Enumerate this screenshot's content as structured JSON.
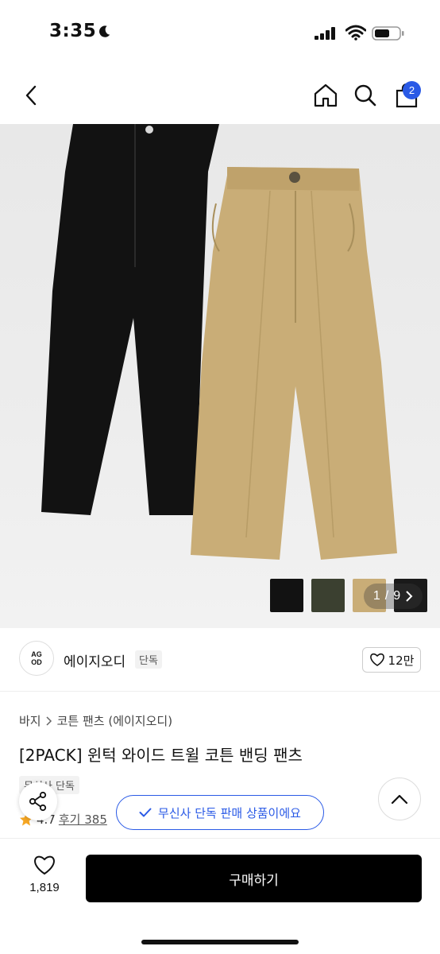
{
  "status_bar": {
    "time": "3:35"
  },
  "nav": {
    "cart_badge": "2"
  },
  "gallery": {
    "page_current": "1",
    "page_separator": "/",
    "page_total": "9",
    "colors": {
      "black": "#121212",
      "khaki": "#c9ad77",
      "olive": "#3b4030"
    }
  },
  "brand": {
    "logo_top": "AG",
    "logo_bottom": "OD",
    "name": "에이지오디",
    "tag": "단독",
    "likes": "12만"
  },
  "product": {
    "breadcrumb": [
      "바지",
      "코튼 팬츠 (에이지오디)"
    ],
    "title": "[2PACK] 윈턱 와이드 트윌 코튼 밴딩 팬츠",
    "exclusive_tag": "무신사 단독",
    "rating": "4.7",
    "reviews": "후기 385"
  },
  "toast": {
    "text": "무신사 단독 판매 상품이에요"
  },
  "bottom_bar": {
    "wish_count": "1,819",
    "buy_label": "구매하기"
  },
  "accent_color": "#2a5ae6"
}
